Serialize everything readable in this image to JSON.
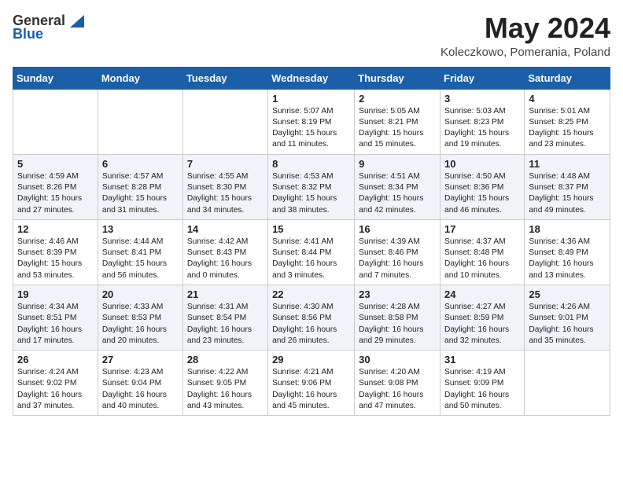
{
  "header": {
    "logo_general": "General",
    "logo_blue": "Blue",
    "month_year": "May 2024",
    "location": "Koleczkowo, Pomerania, Poland"
  },
  "calendar": {
    "days_of_week": [
      "Sunday",
      "Monday",
      "Tuesday",
      "Wednesday",
      "Thursday",
      "Friday",
      "Saturday"
    ],
    "weeks": [
      [
        {
          "day": "",
          "content": ""
        },
        {
          "day": "",
          "content": ""
        },
        {
          "day": "",
          "content": ""
        },
        {
          "day": "1",
          "content": "Sunrise: 5:07 AM\nSunset: 8:19 PM\nDaylight: 15 hours and 11 minutes."
        },
        {
          "day": "2",
          "content": "Sunrise: 5:05 AM\nSunset: 8:21 PM\nDaylight: 15 hours and 15 minutes."
        },
        {
          "day": "3",
          "content": "Sunrise: 5:03 AM\nSunset: 8:23 PM\nDaylight: 15 hours and 19 minutes."
        },
        {
          "day": "4",
          "content": "Sunrise: 5:01 AM\nSunset: 8:25 PM\nDaylight: 15 hours and 23 minutes."
        }
      ],
      [
        {
          "day": "5",
          "content": "Sunrise: 4:59 AM\nSunset: 8:26 PM\nDaylight: 15 hours and 27 minutes."
        },
        {
          "day": "6",
          "content": "Sunrise: 4:57 AM\nSunset: 8:28 PM\nDaylight: 15 hours and 31 minutes."
        },
        {
          "day": "7",
          "content": "Sunrise: 4:55 AM\nSunset: 8:30 PM\nDaylight: 15 hours and 34 minutes."
        },
        {
          "day": "8",
          "content": "Sunrise: 4:53 AM\nSunset: 8:32 PM\nDaylight: 15 hours and 38 minutes."
        },
        {
          "day": "9",
          "content": "Sunrise: 4:51 AM\nSunset: 8:34 PM\nDaylight: 15 hours and 42 minutes."
        },
        {
          "day": "10",
          "content": "Sunrise: 4:50 AM\nSunset: 8:36 PM\nDaylight: 15 hours and 46 minutes."
        },
        {
          "day": "11",
          "content": "Sunrise: 4:48 AM\nSunset: 8:37 PM\nDaylight: 15 hours and 49 minutes."
        }
      ],
      [
        {
          "day": "12",
          "content": "Sunrise: 4:46 AM\nSunset: 8:39 PM\nDaylight: 15 hours and 53 minutes."
        },
        {
          "day": "13",
          "content": "Sunrise: 4:44 AM\nSunset: 8:41 PM\nDaylight: 15 hours and 56 minutes."
        },
        {
          "day": "14",
          "content": "Sunrise: 4:42 AM\nSunset: 8:43 PM\nDaylight: 16 hours and 0 minutes."
        },
        {
          "day": "15",
          "content": "Sunrise: 4:41 AM\nSunset: 8:44 PM\nDaylight: 16 hours and 3 minutes."
        },
        {
          "day": "16",
          "content": "Sunrise: 4:39 AM\nSunset: 8:46 PM\nDaylight: 16 hours and 7 minutes."
        },
        {
          "day": "17",
          "content": "Sunrise: 4:37 AM\nSunset: 8:48 PM\nDaylight: 16 hours and 10 minutes."
        },
        {
          "day": "18",
          "content": "Sunrise: 4:36 AM\nSunset: 8:49 PM\nDaylight: 16 hours and 13 minutes."
        }
      ],
      [
        {
          "day": "19",
          "content": "Sunrise: 4:34 AM\nSunset: 8:51 PM\nDaylight: 16 hours and 17 minutes."
        },
        {
          "day": "20",
          "content": "Sunrise: 4:33 AM\nSunset: 8:53 PM\nDaylight: 16 hours and 20 minutes."
        },
        {
          "day": "21",
          "content": "Sunrise: 4:31 AM\nSunset: 8:54 PM\nDaylight: 16 hours and 23 minutes."
        },
        {
          "day": "22",
          "content": "Sunrise: 4:30 AM\nSunset: 8:56 PM\nDaylight: 16 hours and 26 minutes."
        },
        {
          "day": "23",
          "content": "Sunrise: 4:28 AM\nSunset: 8:58 PM\nDaylight: 16 hours and 29 minutes."
        },
        {
          "day": "24",
          "content": "Sunrise: 4:27 AM\nSunset: 8:59 PM\nDaylight: 16 hours and 32 minutes."
        },
        {
          "day": "25",
          "content": "Sunrise: 4:26 AM\nSunset: 9:01 PM\nDaylight: 16 hours and 35 minutes."
        }
      ],
      [
        {
          "day": "26",
          "content": "Sunrise: 4:24 AM\nSunset: 9:02 PM\nDaylight: 16 hours and 37 minutes."
        },
        {
          "day": "27",
          "content": "Sunrise: 4:23 AM\nSunset: 9:04 PM\nDaylight: 16 hours and 40 minutes."
        },
        {
          "day": "28",
          "content": "Sunrise: 4:22 AM\nSunset: 9:05 PM\nDaylight: 16 hours and 43 minutes."
        },
        {
          "day": "29",
          "content": "Sunrise: 4:21 AM\nSunset: 9:06 PM\nDaylight: 16 hours and 45 minutes."
        },
        {
          "day": "30",
          "content": "Sunrise: 4:20 AM\nSunset: 9:08 PM\nDaylight: 16 hours and 47 minutes."
        },
        {
          "day": "31",
          "content": "Sunrise: 4:19 AM\nSunset: 9:09 PM\nDaylight: 16 hours and 50 minutes."
        },
        {
          "day": "",
          "content": ""
        }
      ]
    ]
  }
}
